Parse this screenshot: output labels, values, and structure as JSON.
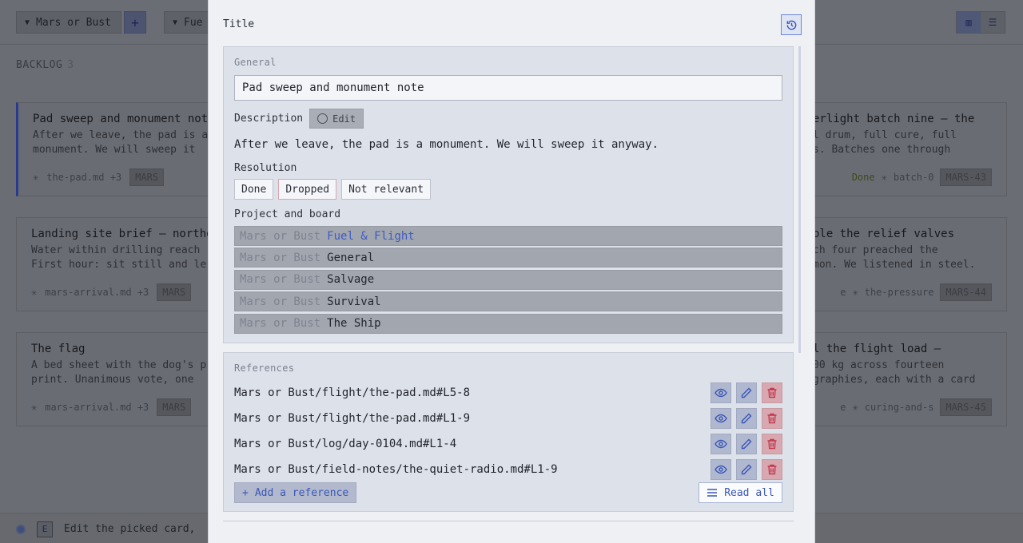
{
  "board": {
    "project_name": "Mars or Bust",
    "second_select": "Fue",
    "add_symbol": "+",
    "view_icons": [
      "board-view-icon",
      "list-view-icon"
    ],
    "backlog_label": "BACKLOG",
    "backlog_count": "3",
    "cards_left": [
      {
        "title": "Pad sweep and monument note",
        "desc1": "After we leave, the pad is a",
        "desc2": "monument. We will sweep it",
        "file": "the-pad.md +3",
        "tag": "MARS"
      },
      {
        "title": "Landing site brief — northe",
        "desc1": "Water within drilling reach",
        "desc2": "First hour: sit still and le",
        "file": "mars-arrival.md +3",
        "tag": "MARS"
      },
      {
        "title": "The flag",
        "desc1": "A bed sheet with the dog's p",
        "desc2": "print. Unanimous vote, one",
        "file": "mars-arrival.md +3",
        "tag": "MARS"
      }
    ],
    "cards_right": [
      {
        "title": "erlight batch nine — the",
        "desc1": "l drum, full cure, full",
        "desc2": "s. Batches one through",
        "status": "Done",
        "file": "batch-0",
        "tag": "MARS-43"
      },
      {
        "title": "ble the relief valves",
        "desc1": "ch four preached the",
        "desc2": "mon. We listened in steel.",
        "status": "e",
        "file": "the-pressure",
        "tag": "MARS-44"
      },
      {
        "title": "l the flight load —",
        "desc1": "00 kg across fourteen",
        "desc2": "graphies, each with a card",
        "status": "e",
        "file": "curing-and-s",
        "tag": "MARS-45"
      }
    ],
    "bottom_hint": "Edit the picked card,",
    "bottom_key": "E"
  },
  "modal": {
    "title_label": "Title",
    "history_icon": "history-icon",
    "general": {
      "section_label": "General",
      "title_value": "Pad sweep and monument note",
      "description_label": "Description",
      "edit_label": "Edit",
      "description_text": "After we leave, the pad is a monument. We will sweep it anyway.",
      "resolution_label": "Resolution",
      "resolution_options": [
        "Done",
        "Dropped",
        "Not relevant"
      ],
      "project_board_label": "Project and board",
      "boards": [
        {
          "project": "Mars or Bust",
          "board": "Fuel & Flight"
        },
        {
          "project": "Mars or Bust",
          "board": "General"
        },
        {
          "project": "Mars or Bust",
          "board": "Salvage"
        },
        {
          "project": "Mars or Bust",
          "board": "Survival"
        },
        {
          "project": "Mars or Bust",
          "board": "The Ship"
        }
      ]
    },
    "references": {
      "section_label": "References",
      "items": [
        "Mars or Bust/flight/the-pad.md#L5-8",
        "Mars or Bust/flight/the-pad.md#L1-9",
        "Mars or Bust/log/day-0104.md#L1-4",
        "Mars or Bust/field-notes/the-quiet-radio.md#L1-9"
      ],
      "add_label": "Add a reference",
      "read_all_label": "Read all"
    }
  },
  "colors": {
    "accent": "#3a56b8",
    "danger": "#c0394f",
    "overlay": "#6b6d74"
  }
}
